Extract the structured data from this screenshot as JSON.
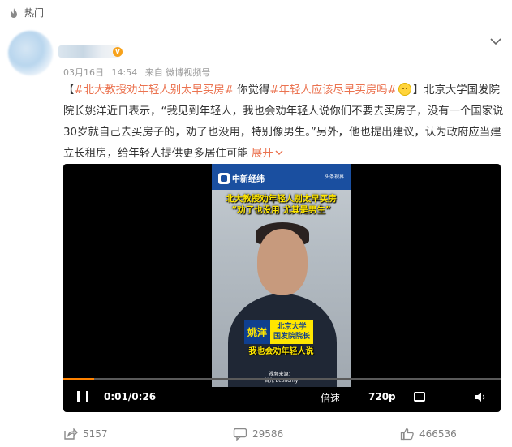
{
  "section": {
    "label": "热门",
    "icon": "fire-icon"
  },
  "post": {
    "date": "03月16日",
    "time": "14:54",
    "source": "来自 微博视频号",
    "text": {
      "open_bracket": "【",
      "topic1": "#北大教授劝年轻人别太早买房#",
      "mid1": " 你觉得",
      "topic2": "#年轻人应该尽早买房吗#",
      "body": "】北京大学国发院院长姚洋近日表示，“我见到年轻人，我也会劝年轻人说你们不要去买房子，没有一个国家说30岁就自己去买房子的，劝了也没用，特别像男生。”另外，他也提出建议，认为政府应当建立长租房，给年轻人提供更多居住可能",
      "more": "展开"
    }
  },
  "video": {
    "logo": "中新经纬",
    "logo2": "头条视界",
    "title_line1": "北大教授劝年轻人别太早买房",
    "title_line2": "“劝了也没用 尤其是男生”",
    "name": "姚洋",
    "role_line1": "北京大学",
    "role_line2": "国发院院长",
    "subtitle": "我也会劝年轻人说",
    "source_line1": "视频来源：",
    "source_line2": "首先 Economy",
    "progress": 0.07,
    "time_display": "0:01/0:26",
    "speed_label": "倍速",
    "quality_label": "720p",
    "colors": {
      "progress": "#ff8200",
      "topic": "#eb7350"
    }
  },
  "actions": {
    "share_count": "5157",
    "comment_count": "29586",
    "like_count": "466536"
  }
}
